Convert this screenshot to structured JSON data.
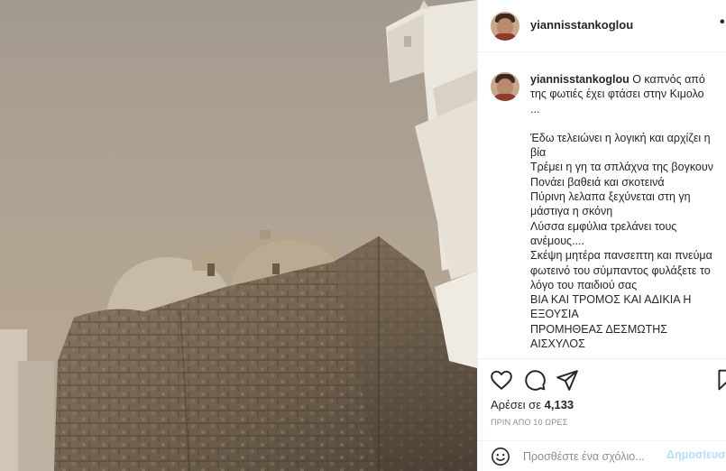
{
  "post": {
    "username": "yiannisstankoglou",
    "more_label": "•••",
    "caption": {
      "username": "yiannisstankoglou",
      "first_line": "Ο καπνός από της φωτιές έχει φτάσει στην Κιμολο",
      "ellipsis": "...",
      "lines": [
        "Έδω τελειώνει η λογική και αρχίζει η βία",
        "Τρέμει η γη τα σπλάχνα της βογκουν",
        "Πονάει βαθειά και σκοτεινά",
        "Πύρινη λελαπα ξεχύνεται στη γη μάστιγα η σκόνη",
        "Λύσσα εμφύλια τρελάνει τους ανέμους....",
        "Σκέψη μητέρα πανσεπτη και πνεύμα φωτεινό του σύμπαντος φυλάξετε το λόγο του παιδιού σας",
        "ΒΙΑ ΚΑΙ ΤΡΟΜΟΣ ΚΑΙ ΑΔΙΚΙΑ Η ΕΞΟΥΣΙΑ",
        "ΠΡΟΜΗΘΕΑΣ ΔΕΣΜΩΤΗΣ",
        "ΑΙΣΧΥΛΟΣ"
      ]
    },
    "likes_label": "Αρέσει σε",
    "likes_count": "4,133",
    "timestamp": "ΠΡΙΝ ΑΠΟ 10 ΩΡΕΣ",
    "comment": {
      "placeholder": "Προσθέστε ένα σχόλιο...",
      "post_label": "Δημοσίευση"
    }
  },
  "icons": {
    "like": "heart-icon",
    "comment": "comment-icon",
    "share": "send-icon",
    "save": "bookmark-icon",
    "emoji": "emoji-icon",
    "more": "more-icon"
  },
  "colors": {
    "text": "#262626",
    "muted": "#8e8e8e",
    "divider": "#efefef",
    "post_button_disabled": "#b2dffc"
  }
}
